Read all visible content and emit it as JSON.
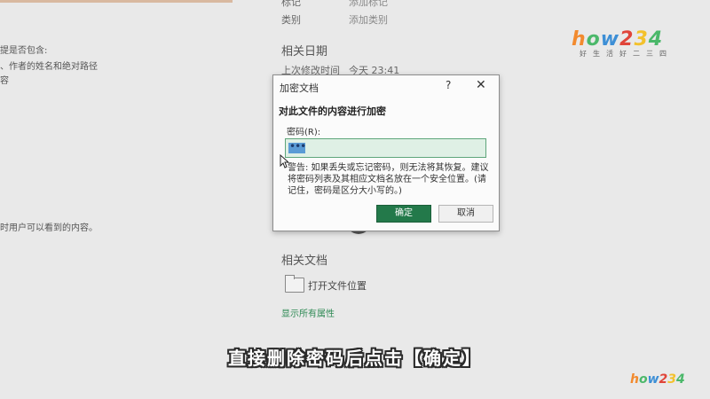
{
  "left_panel": {
    "lines": [
      "提是否包含:",
      "、作者的姓名和绝对路径",
      "容",
      "时用户可以看到的内容。"
    ]
  },
  "properties": {
    "tag_label": "标记",
    "tag_value": "添加标记",
    "category_label": "类别",
    "category_value": "添加类别",
    "dates_section": "相关日期",
    "last_modified_label": "上次修改时间",
    "last_modified_value": "今天 23:41",
    "related_docs_section": "相关文档",
    "open_location": "打开文件位置",
    "show_all": "显示所有属性"
  },
  "dialog": {
    "title": "加密文档",
    "help": "?",
    "close": "✕",
    "heading": "对此文件的内容进行加密",
    "password_label": "密码(R):",
    "password_value": "•••",
    "warning": "警告: 如果丢失或忘记密码，则无法将其恢复。建议将密码列表及其相应文档名放在一个安全位置。(请记住，密码是区分大小写的。)",
    "ok": "确定",
    "cancel": "取消"
  },
  "caption": "直接删除密码后点击【确定】",
  "logo": {
    "parts": [
      "h",
      "o",
      "w",
      "2",
      "3",
      "4"
    ],
    "sub": "好生活好二三四"
  },
  "colors": {
    "accent_green": "#23794a",
    "link_green": "#2f8a55",
    "selection_blue": "#5b9bd5"
  }
}
